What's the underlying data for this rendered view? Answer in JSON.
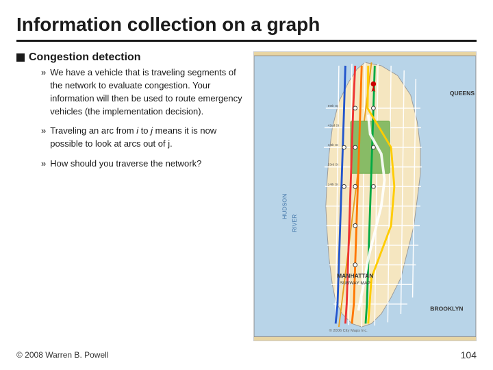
{
  "slide": {
    "title": "Information collection on a graph",
    "bullet_main": "Congestion detection",
    "sub_bullets": [
      {
        "text": "We have a vehicle that is traveling segments of the network to evaluate congestion. Your information will then be used to route emergency vehicles (the implementation decision)."
      },
      {
        "text": "Traveling an arc from i to j means it is now possible to look at arcs out of j.",
        "italic_parts": [
          "i",
          "j",
          "j"
        ]
      },
      {
        "text": "How should you traverse the network?"
      }
    ],
    "footer": {
      "copyright": "© 2008 Warren B. Powell",
      "page_number": "104"
    }
  }
}
